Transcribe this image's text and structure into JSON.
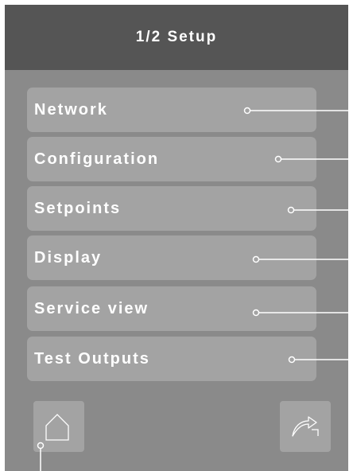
{
  "header": {
    "title": "1/2 Setup"
  },
  "menu": {
    "items": [
      {
        "label": "Network"
      },
      {
        "label": "Configuration"
      },
      {
        "label": "Setpoints"
      },
      {
        "label": "Display"
      },
      {
        "label": "Service view"
      },
      {
        "label": "Test Outputs"
      }
    ]
  },
  "footer": {
    "home_icon": "home-icon",
    "next_page_icon": "next-page-arrow-icon"
  },
  "colors": {
    "header_bg": "#555555",
    "screen_bg": "#8a8a8a",
    "button_bg": "#a3a3a3",
    "text": "#ffffff",
    "callout_line": "#ffffff"
  }
}
